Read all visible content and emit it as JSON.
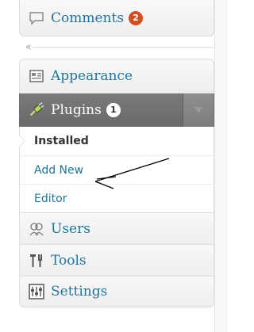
{
  "menu": {
    "comments": {
      "label": "Comments",
      "badge": "2",
      "icon": "comment-icon"
    },
    "collapse": {
      "glyph": "«"
    },
    "appearance": {
      "label": "Appearance",
      "icon": "appearance-icon"
    },
    "plugins": {
      "label": "Plugins",
      "badge": "1",
      "icon": "plugin-icon"
    },
    "plugins_sub": [
      {
        "label": "Installed",
        "current": true
      },
      {
        "label": "Add New"
      },
      {
        "label": "Editor"
      }
    ],
    "users": {
      "label": "Users",
      "icon": "users-icon"
    },
    "tools": {
      "label": "Tools",
      "icon": "tools-icon"
    },
    "settings": {
      "label": "Settings",
      "icon": "settings-icon"
    }
  },
  "colors": {
    "link": "#21759b",
    "badge_red": "#d54e21",
    "active_bg": "#777777"
  }
}
